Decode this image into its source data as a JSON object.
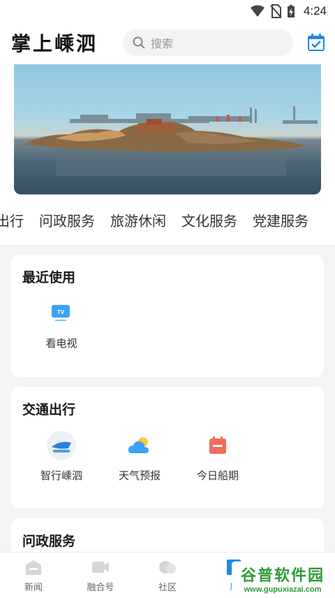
{
  "status_bar": {
    "time": "4:24"
  },
  "header": {
    "app_title": "掌上嵊泗",
    "search_placeholder": "搜索"
  },
  "category_tabs": [
    {
      "label": "出行"
    },
    {
      "label": "问政服务"
    },
    {
      "label": "旅游休闲"
    },
    {
      "label": "文化服务"
    },
    {
      "label": "党建服务"
    }
  ],
  "sections": {
    "recent": {
      "title": "最近使用",
      "items": [
        {
          "label": "看电视",
          "icon": "tv-icon"
        }
      ]
    },
    "traffic": {
      "title": "交通出行",
      "items": [
        {
          "label": "智行嵊泗",
          "icon": "zhixing-shengsi-icon"
        },
        {
          "label": "天气预报",
          "icon": "weather-icon"
        },
        {
          "label": "今日船期",
          "icon": "ship-schedule-icon"
        }
      ]
    },
    "gov": {
      "title": "问政服务"
    }
  },
  "bottom_nav": [
    {
      "label": "新闻",
      "icon": "news-icon"
    },
    {
      "label": "融合号",
      "icon": "video-icon"
    },
    {
      "label": "社区",
      "icon": "community-icon"
    },
    {
      "label": "服",
      "icon": "service-icon",
      "active": true
    },
    {
      "label": "",
      "icon": "mine-icon"
    }
  ],
  "watermark": {
    "main": "谷普软件园",
    "sub": "www.gupuxiazai.com"
  },
  "colors": {
    "accent": "#1e88e5",
    "watermark": "#2e9b3a"
  }
}
